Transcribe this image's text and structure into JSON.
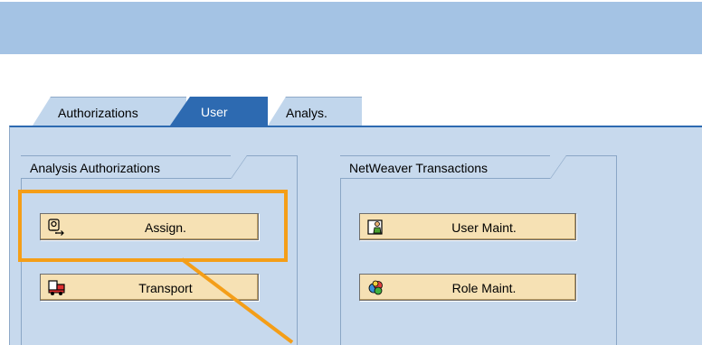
{
  "tabs": [
    {
      "label": "Authorizations",
      "active": false
    },
    {
      "label": "User",
      "active": true
    },
    {
      "label": "Analys.",
      "active": false
    }
  ],
  "groups": {
    "analysis": {
      "title": "Analysis Authorizations",
      "buttons": [
        {
          "label": "Assign.",
          "icon": "assign-icon"
        },
        {
          "label": "Transport",
          "icon": "truck-icon"
        }
      ]
    },
    "netweaver": {
      "title": "NetWeaver Transactions",
      "buttons": [
        {
          "label": "User Maint.",
          "icon": "user-maint-icon"
        },
        {
          "label": "Role Maint.",
          "icon": "role-maint-icon"
        }
      ]
    }
  },
  "colors": {
    "header": "#a4c3e4",
    "active_tab": "#2d6ab1",
    "panel": "#c7d9ed",
    "button": "#f6e1b4",
    "highlight": "#f49e18"
  }
}
